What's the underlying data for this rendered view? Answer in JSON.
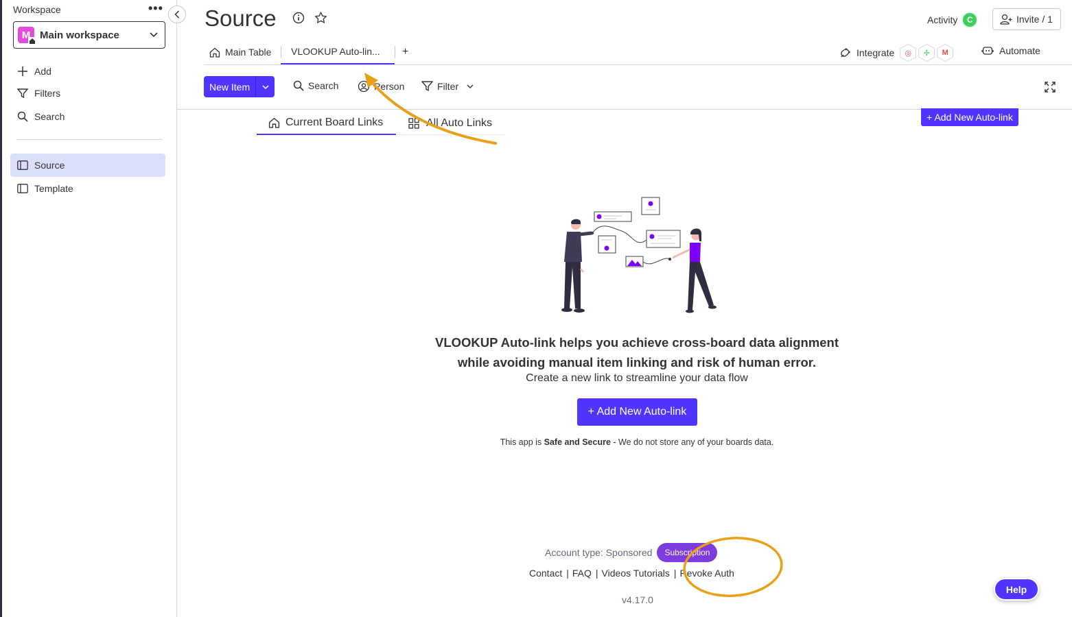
{
  "sidebar": {
    "workspace_label": "Workspace",
    "more_label": "•••",
    "workspace_avatar": "M",
    "workspace_name": "Main workspace",
    "actions": [
      {
        "label": "Add",
        "icon": "plus-icon"
      },
      {
        "label": "Filters",
        "icon": "filter-icon"
      },
      {
        "label": "Search",
        "icon": "search-icon"
      }
    ],
    "boards": [
      {
        "label": "Source",
        "active": true
      },
      {
        "label": "Template",
        "active": false
      }
    ]
  },
  "header": {
    "title": "Source",
    "activity_label": "Activity",
    "activity_avatar": "C",
    "invite_label": "Invite / 1"
  },
  "view_tabs": {
    "tabs": [
      {
        "label": "Main Table",
        "icon": "home-icon",
        "active": false
      },
      {
        "label": "VLOOKUP Auto-lin...",
        "active": true
      }
    ],
    "add_label": "+",
    "integrate_label": "Integrate",
    "integrate_apps": [
      "gmail-icon",
      "slack-icon",
      "gmail-m-icon"
    ],
    "automate_label": "Automate"
  },
  "toolbar": {
    "new_item_label": "New Item",
    "search_label": "Search",
    "person_label": "Person",
    "filter_label": "Filter"
  },
  "app": {
    "sub_tabs": [
      {
        "label": "Current Board Links",
        "active": true
      },
      {
        "label": "All Auto Links",
        "active": false
      }
    ],
    "add_new_top_label": "+ Add New Auto-link",
    "headline_line1": "VLOOKUP Auto-link helps you achieve cross-board data alignment",
    "headline_line2": "while avoiding manual item linking and risk of human error.",
    "subline": "Create a new link to streamline your data flow",
    "add_new_main_label": "+ Add New Auto-link",
    "secure_prefix": "This app is ",
    "secure_bold": "Safe and Secure",
    "secure_suffix": " - We do not store any of your boards data.",
    "footer": {
      "account_type": "Account type: Sponsored",
      "subscription_label": "Subscription",
      "links": [
        "Contact",
        "FAQ",
        "Videos Tutorials",
        "Revoke Auth"
      ],
      "separator": "|",
      "version": "v4.17.0"
    },
    "help_label": "Help"
  },
  "colors": {
    "primary": "#5034ff",
    "subscription": "#7e3bdd",
    "annotation": "#e8a01a",
    "activity_avatar": "#3ccf5d",
    "workspace_avatar": "#e44bdc"
  }
}
